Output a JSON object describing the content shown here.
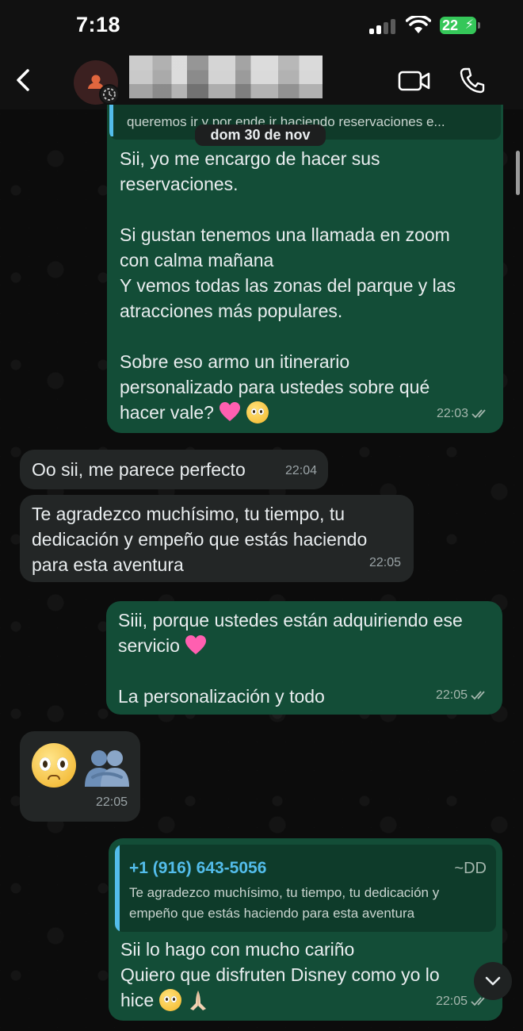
{
  "status_bar": {
    "time": "7:18",
    "battery": "22"
  },
  "header": {
    "contact_name": "",
    "back_icon": "chevron-left-icon",
    "video_icon": "video-camera-icon",
    "call_icon": "phone-icon"
  },
  "colors": {
    "outgoing_bubble": "#134d37",
    "incoming_bubble": "#232626",
    "quote_accent": "#53bdeb",
    "battery": "#35c759"
  },
  "chat": {
    "partial_quote": "queremos ir y por ende ir haciendo reservaciones e...",
    "date_separator": "dom 30 de nov",
    "messages": [
      {
        "direction": "outgoing",
        "lines": [
          "Sii, yo me encargo de hacer sus",
          "reservaciones.",
          "",
          "Si gustan tenemos una llamada en zoom",
          "con calma mañana",
          "Y vemos todas las zonas del parque y las",
          "atracciones más populares.",
          "",
          "Sobre eso armo un itinerario",
          "personalizado para ustedes sobre qué"
        ],
        "last_line": "hacer vale?",
        "time": "22:03"
      },
      {
        "direction": "incoming",
        "text": "Oo sii, me parece perfecto",
        "time": "22:04"
      },
      {
        "direction": "incoming",
        "text": "Te agradezco muchísimo, tu tiempo, tu\ndedicación y empeño que estás haciendo\npara esta aventura",
        "time": "22:05"
      },
      {
        "direction": "outgoing",
        "line1": "Siii, porque ustedes están adquiriendo ese",
        "line2": "servicio",
        "line3": "La personalización y todo",
        "time": "22:05"
      },
      {
        "direction": "incoming",
        "type": "emoji",
        "emojis": [
          "pleading-face-icon",
          "people-hugging-icon"
        ],
        "time": "22:05"
      },
      {
        "direction": "outgoing",
        "reply_to": {
          "author": "+1 (916) 643-5056",
          "tag": "~DD",
          "text": "Te agradezco muchísimo, tu tiempo, tu dedicación y empeño que estás haciendo para esta aventura"
        },
        "line1": "Sii lo hago con mucho cariño",
        "line2": "Quiero que disfruten Disney como yo lo",
        "line3": "hice",
        "time": "22:05"
      }
    ]
  },
  "scroll_down_icon": "chevron-down-icon"
}
